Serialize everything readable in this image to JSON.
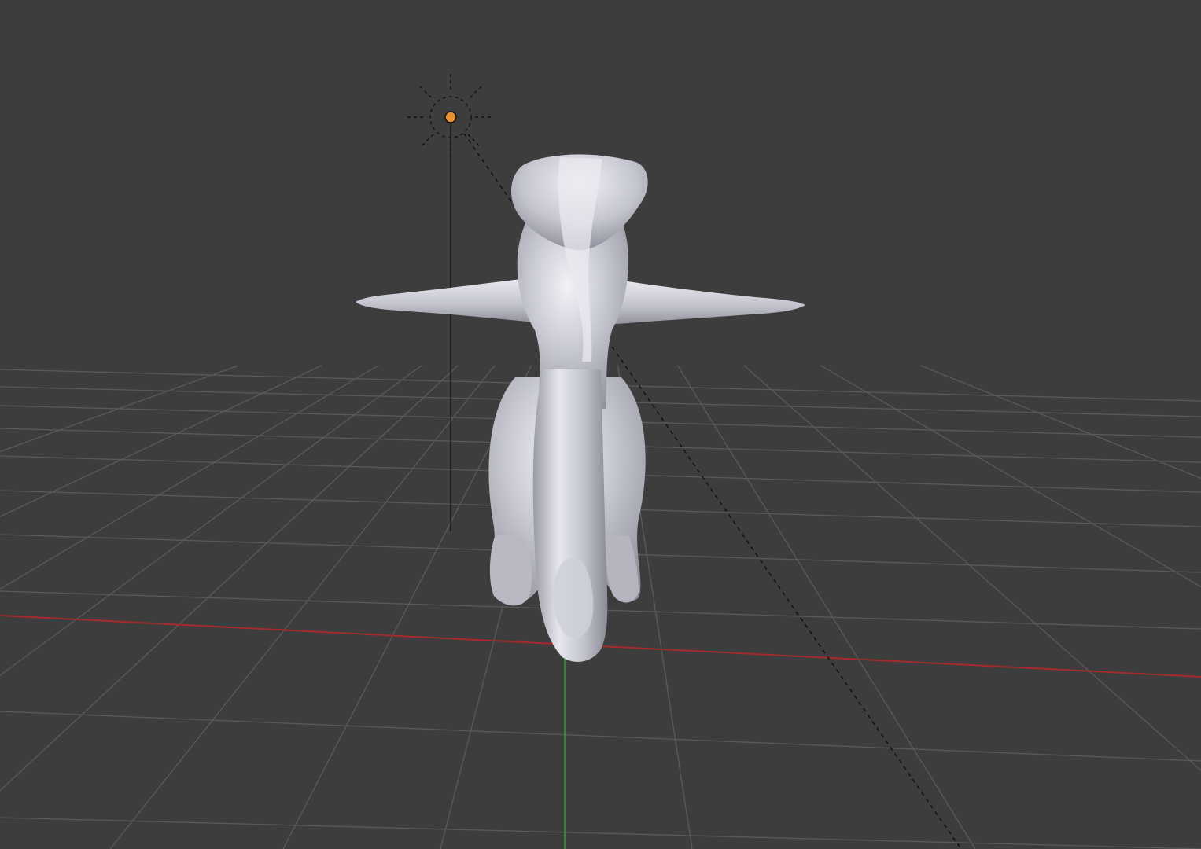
{
  "viewport": {
    "background_color": "#3d3d3d",
    "grid_color": "#5a5a5a",
    "x_axis_color": "#a52a2a",
    "y_axis_color": "#2e8b2e",
    "view": "perspective"
  },
  "scene": {
    "lamp": {
      "icon": "sun-lamp-icon",
      "origin_color": "#e8912f",
      "line_color": "#111111"
    },
    "mesh": {
      "shading": "solid",
      "material_color": "#c8c9d2",
      "shadow_color": "#8e8f9a",
      "highlight_color": "#f2f2f8"
    }
  }
}
